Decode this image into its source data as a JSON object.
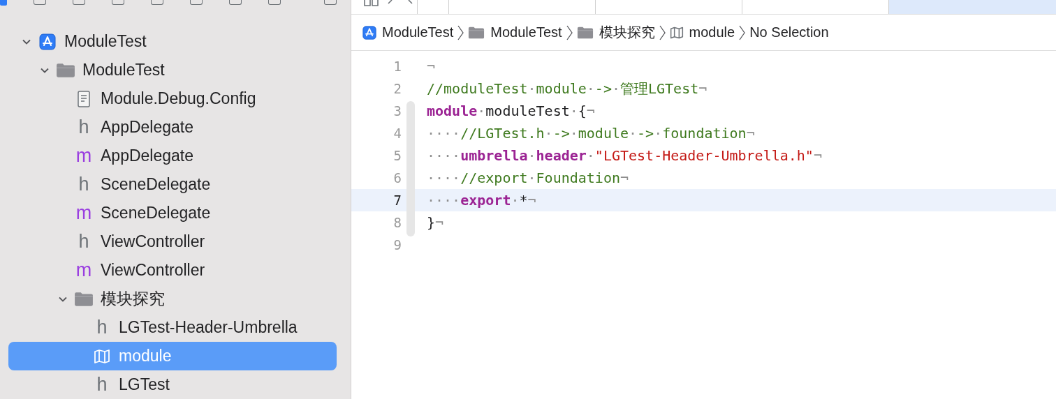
{
  "tabs": [
    {
      "selected": false
    },
    {
      "selected": false
    },
    {
      "selected": false
    },
    {
      "selected": false
    },
    {
      "selected": true
    }
  ],
  "navigator": [
    {
      "label": "ModuleTest",
      "kind": "project",
      "expanded": true,
      "selected": false,
      "children": [
        {
          "label": "ModuleTest",
          "kind": "folder",
          "expanded": true,
          "selected": false,
          "children": [
            {
              "label": "Module.Debug.Config",
              "kind": "config",
              "selected": false
            },
            {
              "label": "AppDelegate",
              "kind": "header",
              "glyph": "h",
              "selected": false
            },
            {
              "label": "AppDelegate",
              "kind": "impl",
              "glyph": "m",
              "selected": false
            },
            {
              "label": "SceneDelegate",
              "kind": "header",
              "glyph": "h",
              "selected": false
            },
            {
              "label": "SceneDelegate",
              "kind": "impl",
              "glyph": "m",
              "selected": false
            },
            {
              "label": "ViewController",
              "kind": "header",
              "glyph": "h",
              "selected": false
            },
            {
              "label": "ViewController",
              "kind": "impl",
              "glyph": "m",
              "selected": false
            },
            {
              "label": "模块探究",
              "kind": "folder",
              "expanded": true,
              "selected": false,
              "children": [
                {
                  "label": "LGTest-Header-Umbrella",
                  "kind": "header",
                  "glyph": "h",
                  "selected": false
                },
                {
                  "label": "module",
                  "kind": "modulemap",
                  "selected": true
                },
                {
                  "label": "LGTest",
                  "kind": "header",
                  "glyph": "h",
                  "selected": false
                }
              ]
            }
          ]
        }
      ]
    }
  ],
  "breadcrumb": [
    {
      "label": "ModuleTest",
      "kind": "project"
    },
    {
      "label": "ModuleTest",
      "kind": "folder"
    },
    {
      "label": "模块探究",
      "kind": "folder"
    },
    {
      "label": "module",
      "kind": "modulemap"
    },
    {
      "label": "No Selection",
      "kind": "none"
    }
  ],
  "code": [
    {
      "number": "1",
      "current": false,
      "tokens": [
        {
          "kind": "eol",
          "text": "¬"
        }
      ]
    },
    {
      "number": "2",
      "current": false,
      "tokens": [
        {
          "kind": "comment",
          "text": "//moduleTest"
        },
        {
          "kind": "ws",
          "text": "·"
        },
        {
          "kind": "comment",
          "text": "module"
        },
        {
          "kind": "ws",
          "text": "·"
        },
        {
          "kind": "comment",
          "text": "->"
        },
        {
          "kind": "ws",
          "text": "·"
        },
        {
          "kind": "comment",
          "text": "管理LGTest"
        },
        {
          "kind": "eol",
          "text": "¬"
        }
      ]
    },
    {
      "number": "3",
      "current": false,
      "tokens": [
        {
          "kind": "keyword",
          "text": "module"
        },
        {
          "kind": "ws",
          "text": "·"
        },
        {
          "kind": "plain",
          "text": "moduleTest"
        },
        {
          "kind": "ws",
          "text": "·"
        },
        {
          "kind": "plain",
          "text": "{"
        },
        {
          "kind": "eol",
          "text": "¬"
        }
      ]
    },
    {
      "number": "4",
      "current": false,
      "tokens": [
        {
          "kind": "ws",
          "text": "····"
        },
        {
          "kind": "comment",
          "text": "//LGTest.h"
        },
        {
          "kind": "ws",
          "text": "·"
        },
        {
          "kind": "comment",
          "text": "->"
        },
        {
          "kind": "ws",
          "text": "·"
        },
        {
          "kind": "comment",
          "text": "module"
        },
        {
          "kind": "ws",
          "text": "·"
        },
        {
          "kind": "comment",
          "text": "->"
        },
        {
          "kind": "ws",
          "text": "·"
        },
        {
          "kind": "comment",
          "text": "foundation"
        },
        {
          "kind": "eol",
          "text": "¬"
        }
      ]
    },
    {
      "number": "5",
      "current": false,
      "tokens": [
        {
          "kind": "ws",
          "text": "····"
        },
        {
          "kind": "keyword",
          "text": "umbrella"
        },
        {
          "kind": "ws",
          "text": "·"
        },
        {
          "kind": "keyword",
          "text": "header"
        },
        {
          "kind": "ws",
          "text": "·"
        },
        {
          "kind": "string",
          "text": "\"LGTest-Header-Umbrella.h\""
        },
        {
          "kind": "eol",
          "text": "¬"
        }
      ]
    },
    {
      "number": "6",
      "current": false,
      "tokens": [
        {
          "kind": "ws",
          "text": "····"
        },
        {
          "kind": "comment",
          "text": "//export"
        },
        {
          "kind": "ws",
          "text": "·"
        },
        {
          "kind": "comment",
          "text": "Foundation"
        },
        {
          "kind": "eol",
          "text": "¬"
        }
      ]
    },
    {
      "number": "7",
      "current": true,
      "tokens": [
        {
          "kind": "ws",
          "text": "····"
        },
        {
          "kind": "keyword",
          "text": "export"
        },
        {
          "kind": "ws",
          "text": "·"
        },
        {
          "kind": "plain",
          "text": "*"
        },
        {
          "kind": "eol",
          "text": "¬"
        }
      ]
    },
    {
      "number": "8",
      "current": false,
      "tokens": [
        {
          "kind": "plain",
          "text": "}"
        },
        {
          "kind": "eol",
          "text": "¬"
        }
      ]
    },
    {
      "number": "9",
      "current": false
    }
  ]
}
